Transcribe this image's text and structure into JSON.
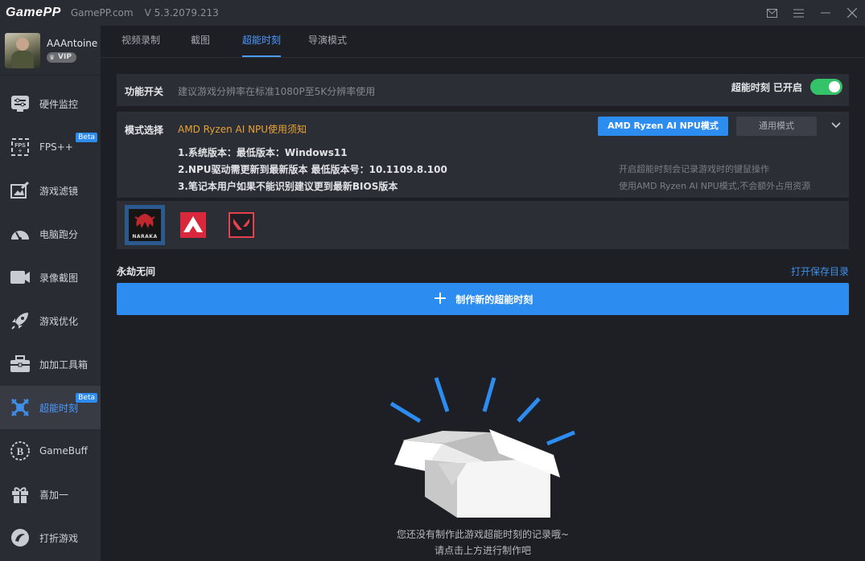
{
  "titlebar": {
    "logo": "GamePP",
    "site": "GamePP.com",
    "version": "V 5.3.2079.213"
  },
  "user": {
    "name": "AAAntoine",
    "badge": "VIP"
  },
  "nav": [
    {
      "label": "硬件监控",
      "icon": "hardware-monitor-icon"
    },
    {
      "label": "FPS++",
      "icon": "fps-icon",
      "badge": "Beta"
    },
    {
      "label": "游戏滤镜",
      "icon": "filter-icon"
    },
    {
      "label": "电脑跑分",
      "icon": "speedometer-icon"
    },
    {
      "label": "录像截图",
      "icon": "camera-icon"
    },
    {
      "label": "游戏优化",
      "icon": "rocket-icon"
    },
    {
      "label": "加加工具箱",
      "icon": "toolbox-icon"
    },
    {
      "label": "超能时刻",
      "icon": "highlight-icon",
      "badge": "Beta",
      "active": true
    },
    {
      "label": "GameBuff",
      "icon": "gamebuff-icon"
    },
    {
      "label": "喜加一",
      "icon": "gift-icon"
    },
    {
      "label": "打折游戏",
      "icon": "discount-icon"
    }
  ],
  "tabs": [
    "视频录制",
    "截图",
    "超能时刻",
    "导演模式"
  ],
  "feature_switch": {
    "label": "功能开关",
    "hint": "建议游戏分辨率在标准1080P至5K分辨率使用",
    "toggle_label": "超能时刻 已开启",
    "enabled": true
  },
  "mode_select": {
    "label": "模式选择",
    "notice": "AMD Ryzen AI NPU使用须知",
    "primary_btn": "AMD Ryzen AI NPU模式",
    "secondary_btn": "通用模式",
    "requirements": [
      "1.系统版本：最低版本：Windows11",
      "2.NPU驱动需更新到最新版本 最低版本号：10.1109.8.100",
      "3.笔记本用户如果不能识别建议更到最新BIOS版本"
    ],
    "notes": [
      "开启超能时刻会记录游戏时的键鼠操作",
      "使用AMD Ryzen AI NPU模式,不会额外占用资源"
    ]
  },
  "games": [
    {
      "name": "NARAKA",
      "icon": "naraka-icon",
      "selected": true
    },
    {
      "name": "",
      "icon": "apex-icon"
    },
    {
      "name": "",
      "icon": "valorant-icon"
    }
  ],
  "section": {
    "title": "永劫无间",
    "open_dir": "打开保存目录",
    "create_label": "制作新的超能时刻"
  },
  "empty": {
    "line1": "您还没有制作此游戏超能时刻的记录哦~",
    "line2": "请点击上方进行制作吧"
  },
  "colors": {
    "accent": "#2d8cf0",
    "warning": "#e8a335",
    "toggle_on": "#35c36a"
  }
}
